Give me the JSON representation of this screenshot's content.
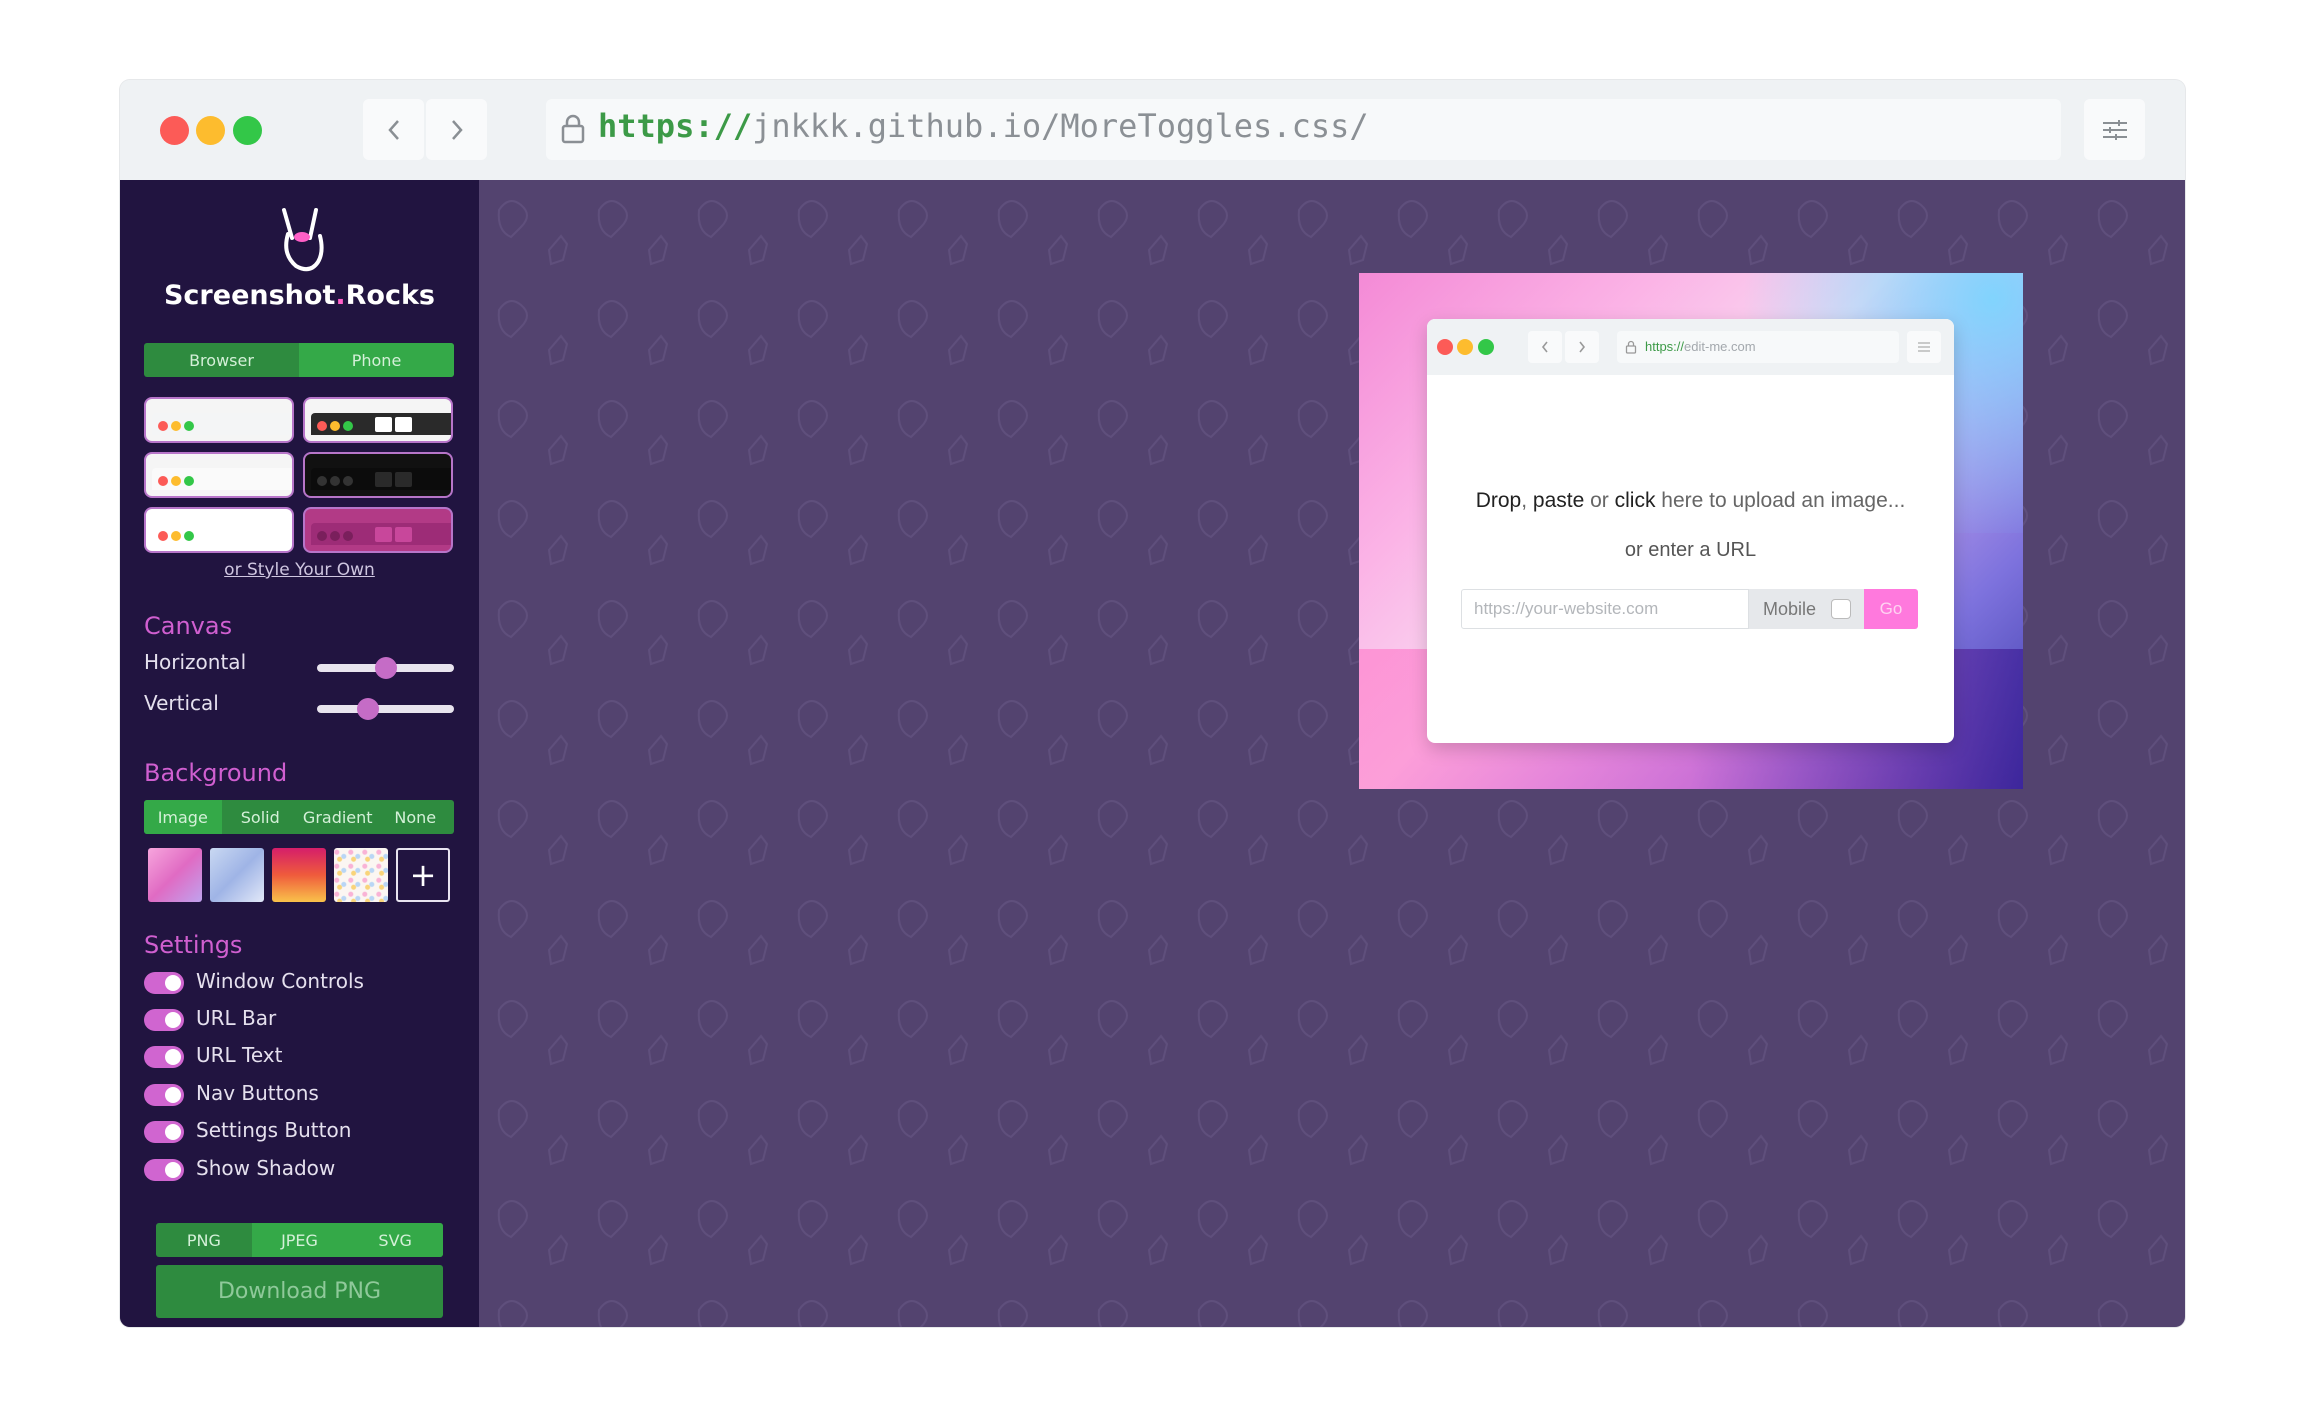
{
  "browser": {
    "url_protocol": "https://",
    "url_rest": "jnkkk.github.io/MoreToggles.css/",
    "back_icon": "chevron-left-icon",
    "forward_icon": "chevron-right-icon",
    "settings_icon": "sliders-icon",
    "lock_icon": "lock-icon"
  },
  "sidebar": {
    "logo_icon": "rock-hand-icon",
    "logo_prefix": "Screenshot",
    "logo_dot": ".",
    "logo_suffix": "Rocks",
    "device_tabs": [
      "Browser",
      "Phone"
    ],
    "style_link": "or Style Your Own",
    "canvas": {
      "title": "Canvas",
      "horizontal_label": "Horizontal",
      "horizontal_value": 0.5,
      "vertical_label": "Vertical",
      "vertical_value": 0.37
    },
    "background": {
      "title": "Background",
      "tabs": [
        "Image",
        "Solid",
        "Gradient",
        "None"
      ],
      "add_label": "+"
    },
    "settings": {
      "title": "Settings",
      "toggles": [
        {
          "label": "Window Controls",
          "on": true
        },
        {
          "label": "URL Bar",
          "on": true
        },
        {
          "label": "URL Text",
          "on": true
        },
        {
          "label": "Nav Buttons",
          "on": true
        },
        {
          "label": "Settings Button",
          "on": true
        },
        {
          "label": "Show Shadow",
          "on": true
        }
      ]
    },
    "formats": [
      "PNG",
      "JPEG",
      "SVG"
    ],
    "download_label": "Download PNG"
  },
  "preview": {
    "url_protocol": "https://",
    "url_rest": "edit-me.com",
    "drop_1": "Drop",
    "drop_2": ", ",
    "drop_3": "paste",
    "drop_4": " or ",
    "drop_5": "click",
    "drop_6": " here to upload an image...",
    "or_url": "or enter a URL",
    "input_placeholder": "https://your-website.com",
    "mobile_label": "Mobile",
    "go_label": "Go"
  },
  "colors": {
    "canvas_bg": "#53436f",
    "sidebar_bg": "#211440",
    "accent_pink": "#d065d0",
    "green": "#2e8b3f"
  }
}
